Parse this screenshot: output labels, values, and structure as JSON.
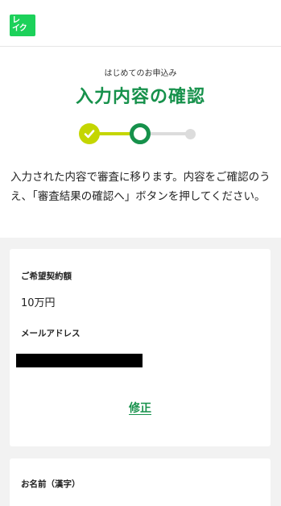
{
  "header": {
    "logo_line1": "レ",
    "logo_line2": "イク"
  },
  "intro": {
    "subtitle": "はじめてのお申込み",
    "title": "入力内容の確認",
    "description": "入力された内容で審査に移ります。内容をご確認のうえ、「審査結果の確認へ」ボタンを押してください。"
  },
  "stepper": {
    "current_step": 2,
    "total_steps": 3
  },
  "card1": {
    "amount_label": "ご希望契約額",
    "amount_value": "10万円",
    "email_label": "メールアドレス",
    "edit_label": "修正"
  },
  "card2": {
    "name_label": "お名前（漢字）"
  },
  "colors": {
    "brand_green": "#16914b",
    "logo_green": "#1cd15a",
    "step_done": "#c4d600",
    "step_todo": "#dcdcdc",
    "background_gray": "#f2f2f2"
  }
}
